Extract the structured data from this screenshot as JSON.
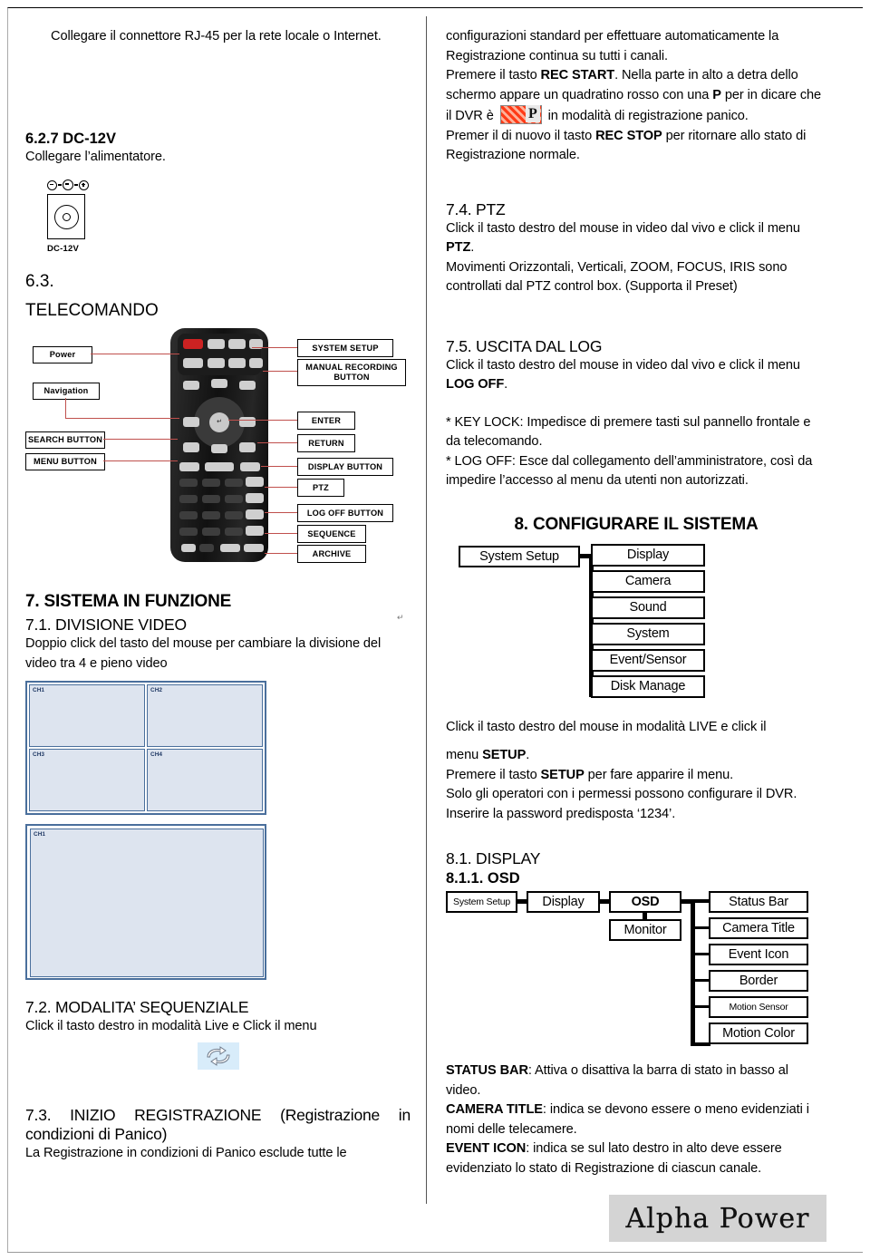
{
  "left_column": {
    "rj45_note": "Collegare il connettore RJ-45 per la rete locale o Internet.",
    "sec_627_title": "6.2.7 DC-12V",
    "sec_627_text": "Collegare l’alimentatore.",
    "psu_label": "DC-12V",
    "sec_63_num": "6.3.",
    "sec_63_title": "TELECOMANDO",
    "remote_callouts": {
      "power": "Power",
      "navigation": "Navigation",
      "search_button": "SEARCH BUTTON",
      "menu_button": "MENU BUTTON",
      "system_setup": "SYSTEM SETUP",
      "manual_recording": "MANUAL RECORDING BUTTON",
      "enter": "ENTER",
      "return": "RETURN",
      "display_button": "DISPLAY BUTTON",
      "ptz": "PTZ",
      "log_off_button": "LOG OFF BUTTON",
      "sequence": "SEQUENCE",
      "archive": "ARCHIVE"
    },
    "sec_7_title": "7. SISTEMA IN FUNZIONE",
    "sec_71_title": "7.1. DIVISIONE VIDEO",
    "sec_71_text": "Doppio click del tasto del mouse per cambiare la divisione del video tra 4 e pieno video",
    "quad_channels": [
      "CH1",
      "CH2",
      "CH3",
      "CH4"
    ],
    "single_channel": "CH1",
    "sec_72_title": "7.2. MODALITA’ SEQUENZIALE",
    "sec_72_text": "Click il tasto destro in modalità Live e Click il menu",
    "sequence_icon": "cycle-arrows-icon",
    "sec_73_title": "7.3. INIZIO REGISTRAZIONE (Registrazione in condizioni di Panico)",
    "sec_73_text": "La Registrazione in condizioni di Panico esclude tutte le"
  },
  "right_column": {
    "panic_para_1": "configurazioni standard per effettuare automaticamente la Registrazione continua su tutti i canali.",
    "panic_para_2_a": "Premere il tasto ",
    "panic_para_2_b": "REC START",
    "panic_para_2_c": ". Nella parte in alto a detra dello schermo appare un quadratino rosso con una ",
    "panic_para_2_d": "P",
    "panic_para_2_e": " per in dicare che il DVR è ",
    "panic_icon": "panic-rec-p-icon",
    "panic_para_2_f": " in modalità di registrazione panico.",
    "panic_para_3_a": "Premer il di nuovo il tasto ",
    "panic_para_3_b": "REC STOP",
    "panic_para_3_c": " per ritornare allo stato di Registrazione normale.",
    "sec_74_title": "7.4. PTZ",
    "sec_74_line1": "Click il tasto destro del mouse in video dal vivo e click il menu",
    "sec_74_bold": "PTZ",
    "sec_74_line2": "Movimenti Orizzontali, Verticali, ZOOM, FOCUS, IRIS sono controllati dal PTZ control box. (Supporta il Preset)",
    "sec_75_title": "7.5. USCITA DAL LOG",
    "sec_75_line1": "Click il tasto destro del mouse in video dal vivo e click il menu",
    "sec_75_bold": "LOG OFF",
    "note_keylock": "* KEY LOCK: Impedisce di premere tasti sul pannello frontale e da telecomando.",
    "note_logoff": "* LOG OFF: Esce dal collegamento dell’amministratore, così da impedire l’accesso al menu da utenti non autorizzati.",
    "sec_8_title": "8. CONFIGURARE IL SISTEMA",
    "tree_setup": {
      "root": "System Setup",
      "children": [
        "Display",
        "Camera",
        "Sound",
        "System",
        "Event/Sensor",
        "Disk Manage"
      ]
    },
    "setup_text_1": "Click il tasto destro del mouse in modalità LIVE e click il",
    "setup_text_2_a": "menu ",
    "setup_text_2_b": "SETUP",
    "setup_text_2_c": ".",
    "setup_text_3_a": "Premere il tasto ",
    "setup_text_3_b": "SETUP",
    "setup_text_3_c": " per fare apparire   il menu.",
    "setup_text_4": "Solo gli operatori con i permessi possono configurare il DVR.",
    "setup_text_5": "Inserire la password predisposta ‘1234’.",
    "sec_81_title": "8.1. DISPLAY",
    "sec_811_title": "8.1.1. OSD",
    "tree_osd": {
      "level1": "System Setup",
      "level2": "Display",
      "level3": "OSD",
      "level3_sibling": "Monitor",
      "children": [
        "Status Bar",
        "Camera Title",
        "Event Icon",
        "Border",
        "Motion Sensor",
        "Motion Color"
      ]
    },
    "desc_statusbar_b": "STATUS BAR",
    "desc_statusbar_t": ": Attiva o disattiva la barra di stato in basso al video.",
    "desc_cameratitle_b": "CAMERA TITLE",
    "desc_cameratitle_t": ": indica se devono essere o meno evidenziati i nomi delle telecamere.",
    "desc_eventicon_b": "EVENT ICON",
    "desc_eventicon_t": ": indica se sul lato destro in alto deve essere evidenziato lo stato di Registrazione di ciascun canale."
  },
  "footer": {
    "brand": "Alpha Power"
  },
  "colors": {
    "video_fill": "#dde4ef",
    "video_border": "#4a6f9c",
    "callout_lead": "#c0504d",
    "panic_red": "#ff3b17",
    "logo_bg": "#d4d4d4"
  }
}
